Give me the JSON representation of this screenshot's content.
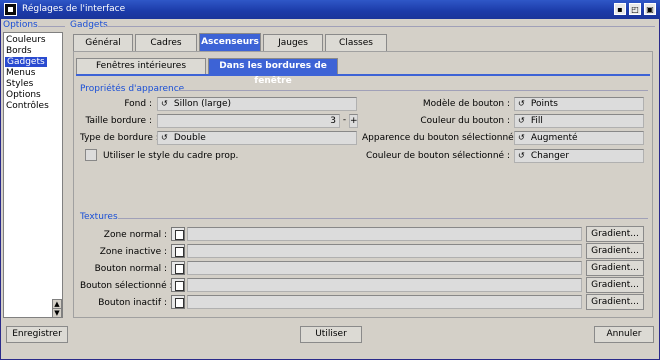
{
  "window": {
    "title": "Réglages de l'interface"
  },
  "options": {
    "title": "Options",
    "items": [
      "Couleurs",
      "Bords",
      "Gadgets",
      "Menus",
      "Styles",
      "Options",
      "Contrôles"
    ],
    "selected": 2
  },
  "gadgets": {
    "title": "Gadgets"
  },
  "tabs": [
    "Général",
    "Cadres",
    "Ascenseurs",
    "Jauges",
    "Classes"
  ],
  "active_tab": 2,
  "subtabs": [
    "Fenêtres intérieures",
    "Dans les bordures de fenêtre"
  ],
  "active_subtab": 1,
  "appearance": {
    "title": "Propriétés d'apparence",
    "fond_label": "Fond :",
    "fond_value": "Sillon (large)",
    "taille_label": "Taille bordure :",
    "taille_value": "3",
    "minus": "-",
    "plus": "+",
    "type_label": "Type de bordure :",
    "type_value": "Double",
    "use_cadre_label": "Utiliser le style du cadre prop.",
    "modele_label": "Modèle de bouton :",
    "modele_value": "Points",
    "couleur_label": "Couleur du bouton :",
    "couleur_value": "Fill",
    "apparence_sel_label": "Apparence du bouton sélectionné :",
    "apparence_sel_value": "Augmenté",
    "couleur_sel_label": "Couleur de bouton sélectionné :",
    "couleur_sel_value": "Changer"
  },
  "textures": {
    "title": "Textures",
    "rows": [
      {
        "label": "Zone normal :",
        "button": "Gradient..."
      },
      {
        "label": "Zone inactive :",
        "button": "Gradient..."
      },
      {
        "label": "Bouton normal :",
        "button": "Gradient..."
      },
      {
        "label": "Bouton sélectionné :",
        "button": "Gradient..."
      },
      {
        "label": "Bouton inactif :",
        "button": "Gradient..."
      }
    ]
  },
  "footer": {
    "save": "Enregistrer",
    "use": "Utiliser",
    "cancel": "Annuler"
  }
}
